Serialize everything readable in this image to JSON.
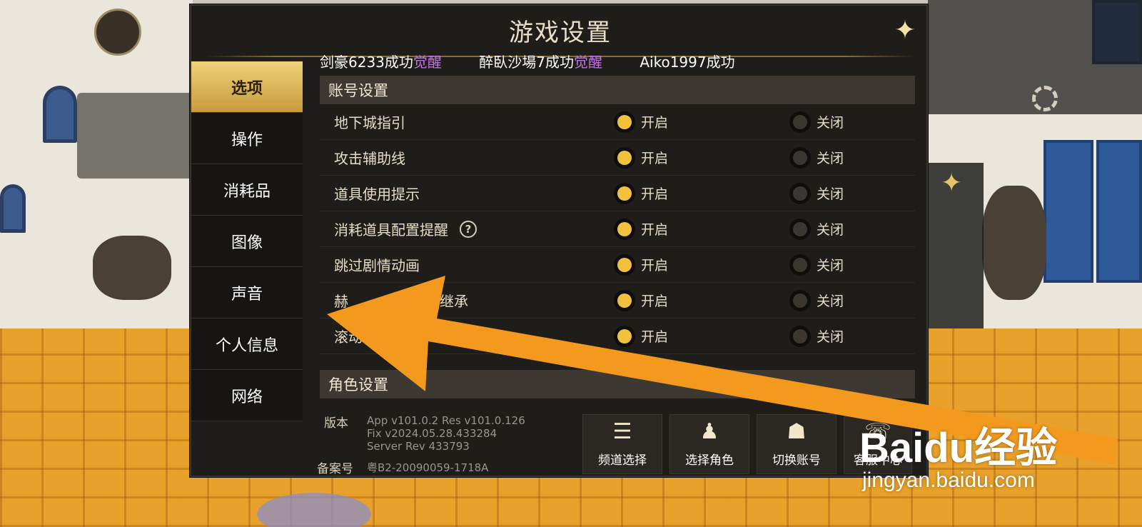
{
  "dialog": {
    "title": "游戏设置",
    "close_icon": "close-x-icon"
  },
  "ticker": [
    {
      "text": "剑豪6233成功",
      "highlight": "觉醒"
    },
    {
      "text": "醉臥沙場7成功",
      "highlight": "觉醒"
    },
    {
      "text": "Aiko1997成功",
      "highlight": ""
    }
  ],
  "sidebar": {
    "items": [
      {
        "label": "选项",
        "active": true
      },
      {
        "label": "操作",
        "active": false
      },
      {
        "label": "消耗品",
        "active": false
      },
      {
        "label": "图像",
        "active": false
      },
      {
        "label": "声音",
        "active": false
      },
      {
        "label": "个人信息",
        "active": false
      },
      {
        "label": "网络",
        "active": false
      }
    ]
  },
  "account_section": {
    "header": "账号设置",
    "on_label": "开启",
    "off_label": "关闭",
    "options": [
      {
        "label": "地下城指引",
        "value": "on",
        "help": false
      },
      {
        "label": "攻击辅助线",
        "value": "on",
        "help": false
      },
      {
        "label": "道具使用提示",
        "value": "on",
        "help": false
      },
      {
        "label": "消耗道具配置提醒",
        "value": "on",
        "help": true
      },
      {
        "label": "跳过剧情动画",
        "value": "on",
        "help": false
      },
      {
        "label": "赫",
        "suffix": "继承",
        "value": "on",
        "help": false
      },
      {
        "label": "滚动",
        "value": "on",
        "help": false
      }
    ]
  },
  "role_section": {
    "header": "角色设置"
  },
  "footer": {
    "version_label": "版本",
    "version_lines": [
      "App v101.0.2 Res v101.0.126",
      "Fix v2024.05.28.433284",
      "Server Rev 433793"
    ],
    "icp_label": "备案号",
    "icp_value": "粤B2-20090059-1718A",
    "buttons": [
      {
        "label": "频道选择",
        "icon": "list-icon"
      },
      {
        "label": "选择角色",
        "icon": "character-icon"
      },
      {
        "label": "切换账号",
        "icon": "users-icon"
      },
      {
        "label": "客服中心",
        "icon": "support-icon"
      }
    ]
  },
  "watermark": {
    "brand": "Baidu经验",
    "url": "jingyan.baidu.com"
  },
  "colors": {
    "accent_gold": "#f2c23e",
    "ticker_highlight": "#c472e6",
    "arrow": "#f39a1e"
  }
}
